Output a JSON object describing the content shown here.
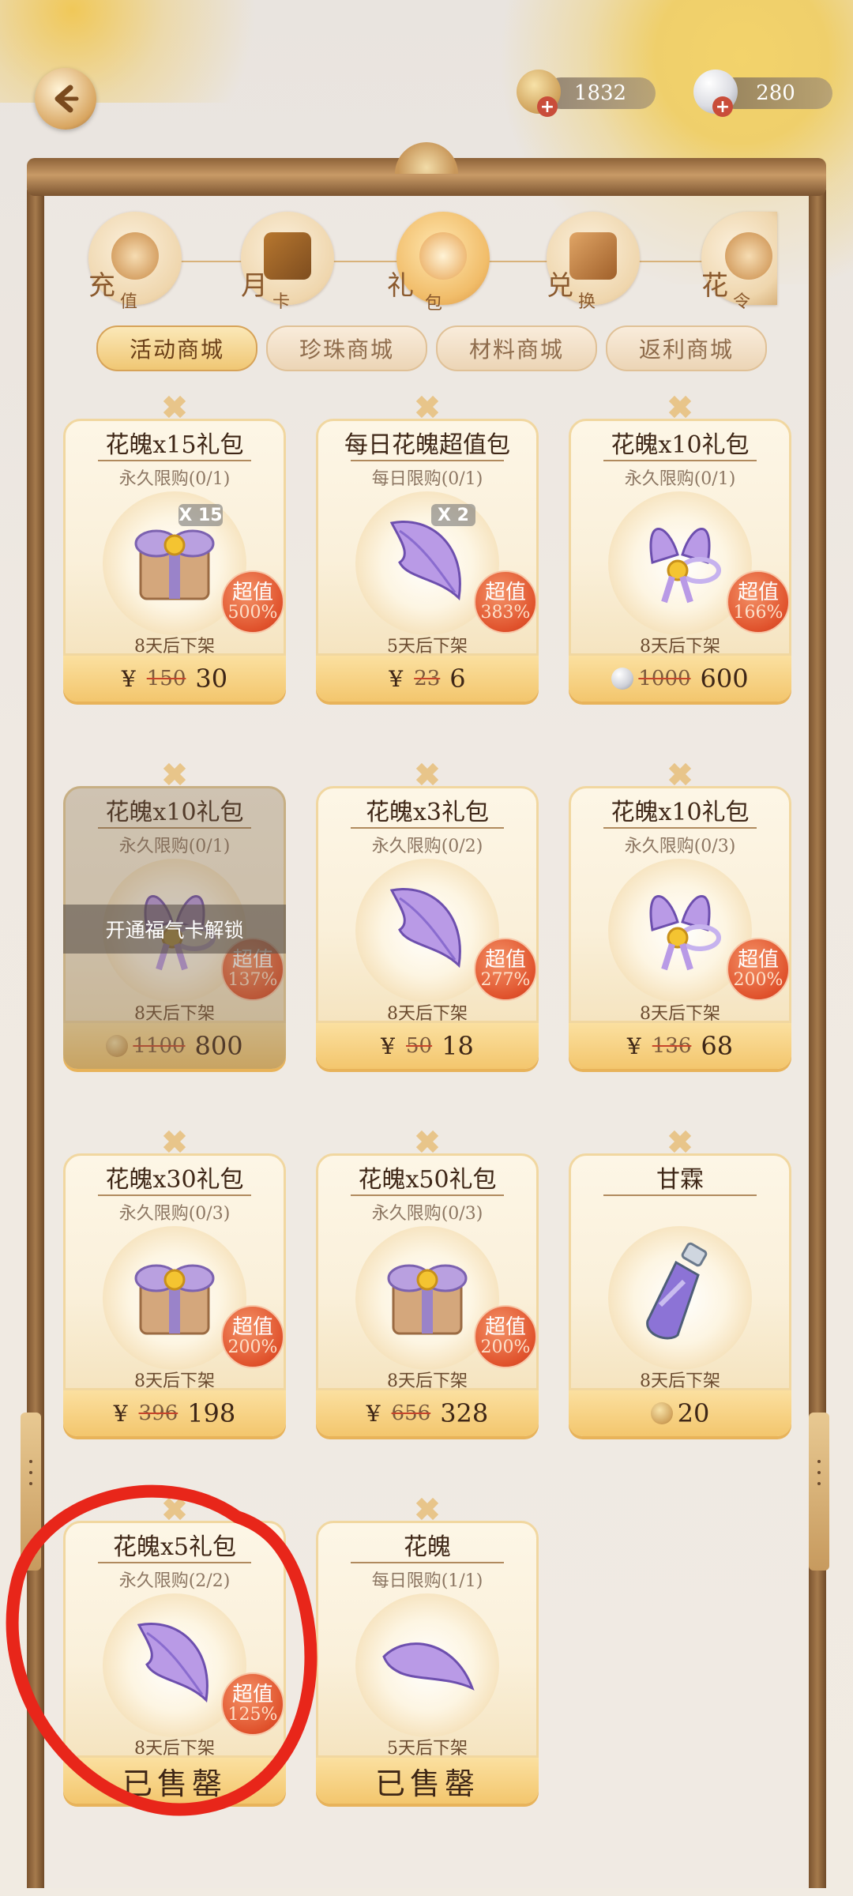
{
  "header": {
    "coins": "1832",
    "pearls": "280"
  },
  "categories": [
    {
      "c1": "充",
      "c2": "值",
      "icon": "coin-icon",
      "active": false
    },
    {
      "c1": "月",
      "c2": "卡",
      "icon": "card-icon",
      "active": false
    },
    {
      "c1": "礼",
      "c2": "包",
      "icon": "gift-pack-icon",
      "active": true
    },
    {
      "c1": "兑",
      "c2": "换",
      "icon": "exchange-gift-icon",
      "active": false
    },
    {
      "c1": "花",
      "c2": "令",
      "icon": "scroll-icon",
      "active": false
    }
  ],
  "subtabs": [
    "活动商城",
    "珍珠商城",
    "材料商城",
    "返利商城"
  ],
  "cards": [
    {
      "name": "花魄x15礼包",
      "limit": "永久限购(0/1)",
      "qty": "X 15",
      "value1": "超值",
      "value2": "500%",
      "expire": "8天后下架",
      "currency": "¥",
      "old": "150",
      "price": "30",
      "item": "gift-box"
    },
    {
      "name": "每日花魄超值包",
      "limit": "每日限购(0/1)",
      "qty": "X 2",
      "value1": "超值",
      "value2": "383%",
      "expire": "5天后下架",
      "currency": "¥",
      "old": "23",
      "price": "6",
      "item": "petal"
    },
    {
      "name": "花魄x10礼包",
      "limit": "永久限购(0/1)",
      "qty": "",
      "value1": "超值",
      "value2": "166%",
      "expire": "8天后下架",
      "currency": "pearl",
      "old": "1000",
      "price": "600",
      "item": "bow"
    },
    {
      "name": "花魄x10礼包",
      "limit": "永久限购(0/1)",
      "qty": "",
      "value1": "超值",
      "value2": "137%",
      "expire": "8天后下架",
      "currency": "coin",
      "old": "1100",
      "price": "800",
      "item": "bow",
      "locked": "开通福气卡解锁"
    },
    {
      "name": "花魄x3礼包",
      "limit": "永久限购(0/2)",
      "qty": "",
      "value1": "超值",
      "value2": "277%",
      "expire": "8天后下架",
      "currency": "¥",
      "old": "50",
      "price": "18",
      "item": "petal"
    },
    {
      "name": "花魄x10礼包",
      "limit": "永久限购(0/3)",
      "qty": "",
      "value1": "超值",
      "value2": "200%",
      "expire": "8天后下架",
      "currency": "¥",
      "old": "136",
      "price": "68",
      "item": "bow"
    },
    {
      "name": "花魄x30礼包",
      "limit": "永久限购(0/3)",
      "qty": "",
      "value1": "超值",
      "value2": "200%",
      "expire": "8天后下架",
      "currency": "¥",
      "old": "396",
      "price": "198",
      "item": "gift-box"
    },
    {
      "name": "花魄x50礼包",
      "limit": "永久限购(0/3)",
      "qty": "",
      "value1": "超值",
      "value2": "200%",
      "expire": "8天后下架",
      "currency": "¥",
      "old": "656",
      "price": "328",
      "item": "gift-box"
    },
    {
      "name": "甘霖",
      "limit": "",
      "qty": "",
      "value1": "",
      "value2": "",
      "expire": "8天后下架",
      "currency": "coin",
      "old": "",
      "price": "20",
      "item": "bottle"
    },
    {
      "name": "花魄x5礼包",
      "limit": "永久限购(2/2)",
      "qty": "",
      "value1": "超值",
      "value2": "125%",
      "expire": "8天后下架",
      "currency": "",
      "old": "",
      "price": "已售罄",
      "item": "petal",
      "sold": true
    },
    {
      "name": "花魄",
      "limit": "每日限购(1/1)",
      "qty": "",
      "value1": "",
      "value2": "",
      "expire": "5天后下架",
      "currency": "",
      "old": "",
      "price": "已售罄",
      "item": "petal-flat",
      "sold": true
    }
  ],
  "colors": {
    "accent": "#f3c66d",
    "value_badge": "#e0522c",
    "annotation": "#e8261a"
  }
}
